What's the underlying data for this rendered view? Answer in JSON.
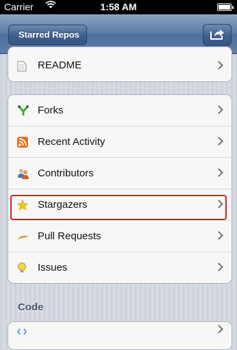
{
  "status_bar": {
    "carrier": "Carrier",
    "time": "1:58 AM"
  },
  "nav": {
    "back_label": "Starred Repos"
  },
  "readme_group": {
    "items": [
      {
        "label": "README",
        "icon": "document-icon"
      }
    ]
  },
  "main_group": {
    "items": [
      {
        "label": "Forks",
        "icon": "fork-icon"
      },
      {
        "label": "Recent Activity",
        "icon": "rss-icon"
      },
      {
        "label": "Contributors",
        "icon": "people-icon"
      },
      {
        "label": "Stargazers",
        "icon": "star-icon"
      },
      {
        "label": "Pull Requests",
        "icon": "pull-request-icon"
      },
      {
        "label": "Issues",
        "icon": "lightbulb-icon"
      }
    ]
  },
  "code_section": {
    "title": "Code"
  },
  "colors": {
    "nav_bar": "#5a7aa5",
    "highlight": "#e01b1b",
    "background": "#d3d7de"
  }
}
